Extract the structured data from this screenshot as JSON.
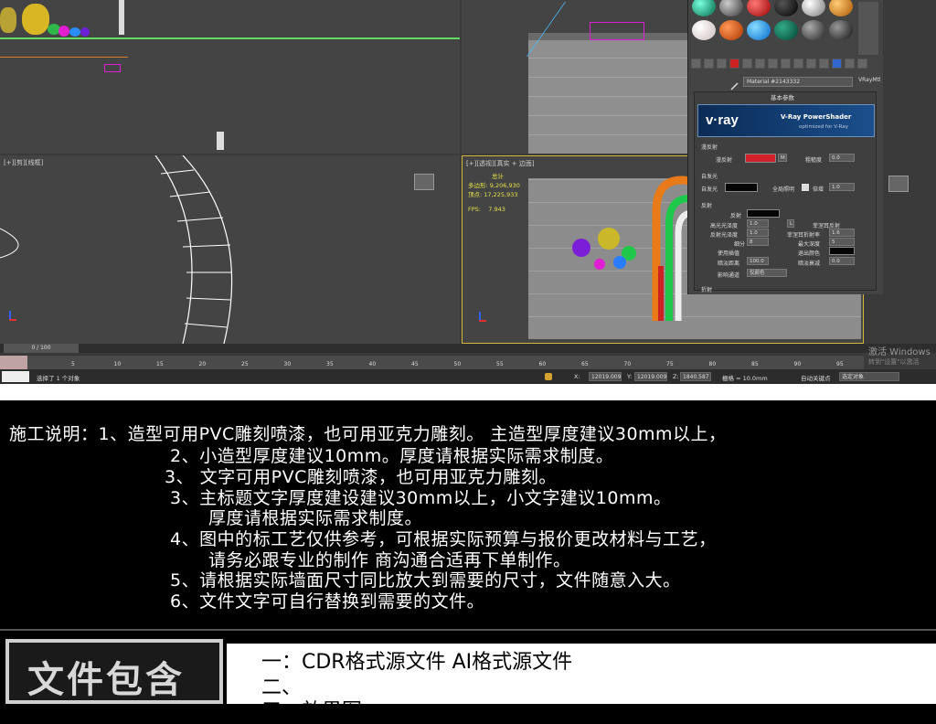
{
  "viewports": {
    "bottom_left_label": "[+][剪][线框]",
    "bottom_right_label": "[+][透视][真实 + 边面]"
  },
  "stats": {
    "total_label": "总计",
    "polys_label": "多边形:",
    "polys_value": "9,206,930",
    "verts_label": "顶点:",
    "verts_value": "17,225,933",
    "fps_label": "FPS:",
    "fps_value": "7.943"
  },
  "material_editor": {
    "material_name": "Material #2143332",
    "material_type": "VRayMtl",
    "basic_params": "基本参数",
    "vray_logo": "v·ray",
    "vray_title": "V-Ray PowerShader",
    "vray_subtitle": "optimized for V-Ray",
    "diffuse_section": "漫反射",
    "diffuse_label": "漫反射",
    "diffuse_btn": "M",
    "roughness_label": "粗糙度",
    "roughness_value": "0.0",
    "selfillum_section": "自发光",
    "selfillum_label": "自发光",
    "gi_label": "全局照明",
    "multiplier_label": "倍增",
    "multiplier_value": "1.0",
    "reflect_section": "反射",
    "reflect_label": "反射",
    "fresnel_label": "菲涅耳反射",
    "hilight_label": "高光光泽度",
    "hilight_value": "1.0",
    "l_btn": "L",
    "refl_gloss_label": "反射光泽度",
    "refl_gloss_value": "1.0",
    "fresnel_ior_label": "菲涅耳折射率",
    "fresnel_ior_value": "1.6",
    "subdivs_label": "细分",
    "subdivs_value": "8",
    "max_depth_label": "最大深度",
    "max_depth_value": "5",
    "interp_label": "使用插值",
    "exit_color_label": "退出颜色",
    "dim_dist_label": "暗淡距离",
    "dim_dist_value": "100.0",
    "dim_falloff_label": "暗淡衰减",
    "dim_falloff_value": "0.0",
    "affect_label": "影响通道",
    "affect_value": "仅颜色",
    "refract_section": "折射"
  },
  "timeline": {
    "frame": "0 / 100",
    "ticks": [
      "5",
      "10",
      "15",
      "20",
      "25",
      "30",
      "35",
      "40",
      "45",
      "50",
      "55",
      "60",
      "65",
      "70",
      "75",
      "80",
      "85",
      "90",
      "95"
    ]
  },
  "status": {
    "selected": "选择了 1 个对象",
    "x_label": "X:",
    "x_value": "12019.009",
    "y_label": "Y:",
    "y_value": "12019.009",
    "z_label": "Z:",
    "z_value": "1840.587",
    "grid": "栅格 = 10.0mm",
    "autokey": "自动关键点",
    "selset": "选定对象"
  },
  "activate": {
    "title": "激活 Windows",
    "sub": "转到\"设置\"以激活"
  },
  "notes": [
    "施工说明：1、造型可用PVC雕刻喷漆，也可用亚克力雕刻。  主造型厚度建议30mm以上，",
    "2、小造型厚度建议10mm。厚度请根据实际需求制度。",
    "3、 文字可用PVC雕刻喷漆，也可用亚克力雕刻。",
    "3、主标题文字厚度建设建议30mm以上，小文字建议10mm。",
    "厚度请根据实际需求制度。",
    "4、图中的标工艺仅供参考，可根据实际预算与报价更改材料与工艺，",
    "请务必跟专业的制作 商沟通合适再下单制作。",
    "5、请根据实际墙面尺寸同比放大到需要的尺寸，文件随意入大。",
    "6、文件文字可自行替换到需要的文件。"
  ],
  "footer": {
    "badge": "文件包含",
    "line1": "一：CDR格式源文件  AI格式源文件",
    "line2": "二、",
    "line3": "三、效果图"
  },
  "colors": {
    "accent_yellow": "#e6e14a",
    "diffuse_red": "#d4202a",
    "vray_blue": "#1b4f8c"
  }
}
